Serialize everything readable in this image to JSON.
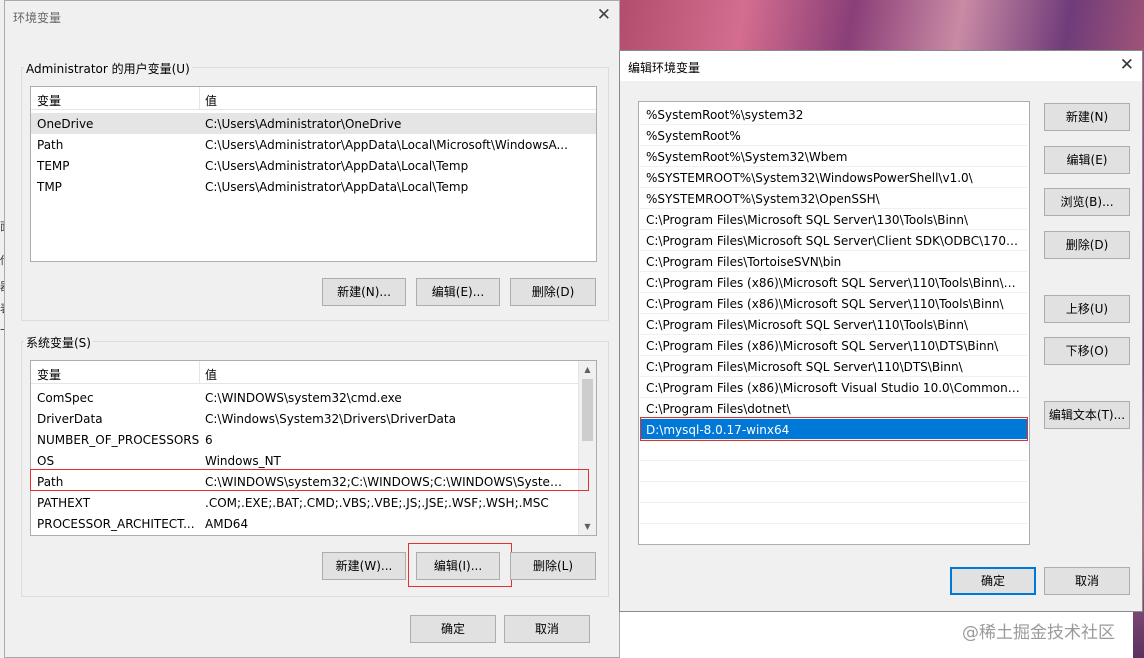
{
  "left_dialog": {
    "title": "环境变量",
    "close_glyph": "✕",
    "user_group_label": "Administrator 的用户变量(U)",
    "system_group_label": "系统变量(S)",
    "columns": {
      "variable": "变量",
      "value": "值"
    },
    "user_vars": [
      {
        "name": "OneDrive",
        "value": "C:\\Users\\Administrator\\OneDrive"
      },
      {
        "name": "Path",
        "value": "C:\\Users\\Administrator\\AppData\\Local\\Microsoft\\WindowsA..."
      },
      {
        "name": "TEMP",
        "value": "C:\\Users\\Administrator\\AppData\\Local\\Temp"
      },
      {
        "name": "TMP",
        "value": "C:\\Users\\Administrator\\AppData\\Local\\Temp"
      }
    ],
    "user_buttons": {
      "new": "新建(N)...",
      "edit": "编辑(E)...",
      "delete": "删除(D)"
    },
    "system_vars": [
      {
        "name": "ComSpec",
        "value": "C:\\WINDOWS\\system32\\cmd.exe"
      },
      {
        "name": "DriverData",
        "value": "C:\\Windows\\System32\\Drivers\\DriverData"
      },
      {
        "name": "NUMBER_OF_PROCESSORS",
        "value": "6"
      },
      {
        "name": "OS",
        "value": "Windows_NT"
      },
      {
        "name": "Path",
        "value": "C:\\WINDOWS\\system32;C:\\WINDOWS;C:\\WINDOWS\\System..."
      },
      {
        "name": "PATHEXT",
        "value": ".COM;.EXE;.BAT;.CMD;.VBS;.VBE;.JS;.JSE;.WSF;.WSH;.MSC"
      },
      {
        "name": "PROCESSOR_ARCHITECT...",
        "value": "AMD64"
      }
    ],
    "system_buttons": {
      "new": "新建(W)...",
      "edit": "编辑(I)...",
      "delete": "删除(L)"
    },
    "footer_buttons": {
      "ok": "确定",
      "cancel": "取消"
    },
    "left_edge_glyphs": [
      "面",
      "传",
      "器",
      "表",
      "卡"
    ]
  },
  "right_dialog": {
    "title": "编辑环境变量",
    "close_glyph": "✕",
    "paths": [
      "%SystemRoot%\\system32",
      "%SystemRoot%",
      "%SystemRoot%\\System32\\Wbem",
      "%SYSTEMROOT%\\System32\\WindowsPowerShell\\v1.0\\",
      "%SYSTEMROOT%\\System32\\OpenSSH\\",
      "C:\\Program Files\\Microsoft SQL Server\\130\\Tools\\Binn\\",
      "C:\\Program Files\\Microsoft SQL Server\\Client SDK\\ODBC\\170\\T...",
      "C:\\Program Files\\TortoiseSVN\\bin",
      "C:\\Program Files (x86)\\Microsoft SQL Server\\110\\Tools\\Binn\\M...",
      "C:\\Program Files (x86)\\Microsoft SQL Server\\110\\Tools\\Binn\\",
      "C:\\Program Files\\Microsoft SQL Server\\110\\Tools\\Binn\\",
      "C:\\Program Files (x86)\\Microsoft SQL Server\\110\\DTS\\Binn\\",
      "C:\\Program Files\\Microsoft SQL Server\\110\\DTS\\Binn\\",
      "C:\\Program Files (x86)\\Microsoft Visual Studio 10.0\\Common7\\I...",
      "C:\\Program Files\\dotnet\\",
      "D:\\mysql-8.0.17-winx64"
    ],
    "selected_index": 15,
    "side_buttons": {
      "new": "新建(N)",
      "edit": "编辑(E)",
      "browse": "浏览(B)...",
      "delete": "删除(D)",
      "move_up": "上移(U)",
      "move_down": "下移(O)",
      "edit_text": "编辑文本(T)..."
    },
    "footer_buttons": {
      "ok": "确定",
      "cancel": "取消"
    }
  },
  "watermark": "@稀土掘金技术社区",
  "colors": {
    "selection": "#0078d7",
    "highlight": "#e03030"
  }
}
